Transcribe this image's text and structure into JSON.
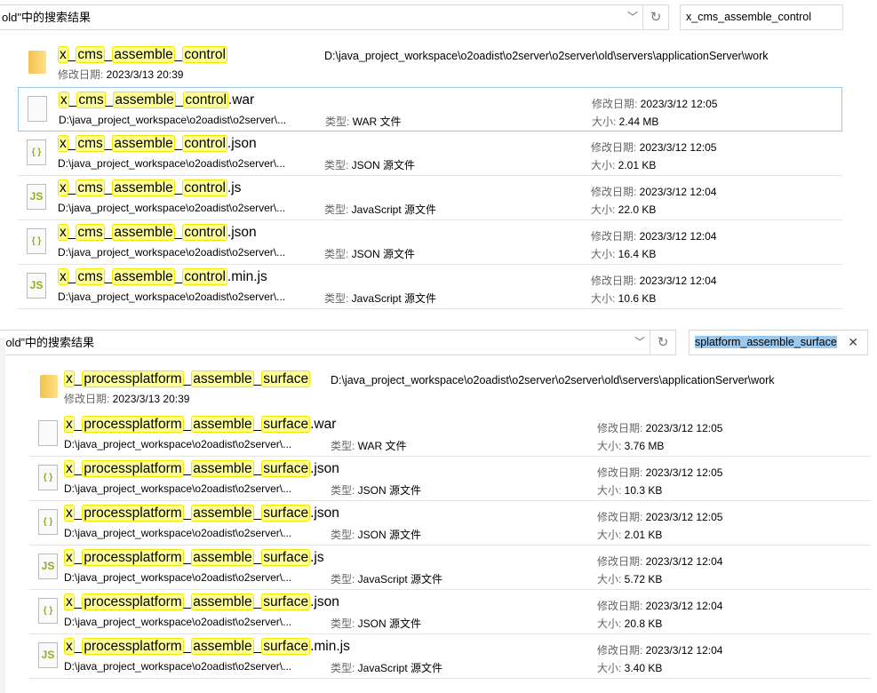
{
  "labels": {
    "date": "修改日期: ",
    "size": "大小: ",
    "type": "类型: "
  },
  "top": {
    "address": "old\"中的搜索结果",
    "search": "x_cms_assemble_control",
    "folder": {
      "parts": [
        "x",
        "cms",
        "assemble",
        "control"
      ],
      "date": "2023/3/13 20:39",
      "path": "D:\\java_project_workspace\\o2oadist\\o2server\\o2server\\old\\servers\\applicationServer\\work"
    },
    "items": [
      {
        "parts": [
          "x",
          "cms",
          "assemble",
          "control"
        ],
        "ext": ".war",
        "icon": "file",
        "path": "D:\\java_project_workspace\\o2oadist\\o2server\\...",
        "type": "WAR 文件",
        "date": "2023/3/12 12:05",
        "size": "2.44 MB"
      },
      {
        "parts": [
          "x",
          "cms",
          "assemble",
          "control"
        ],
        "ext": ".json",
        "icon": "json",
        "path": "D:\\java_project_workspace\\o2oadist\\o2server\\...",
        "type": "JSON 源文件",
        "date": "2023/3/12 12:05",
        "size": "2.01 KB"
      },
      {
        "parts": [
          "x",
          "cms",
          "assemble",
          "control"
        ],
        "ext": ".js",
        "icon": "js",
        "path": "D:\\java_project_workspace\\o2oadist\\o2server\\...",
        "type": "JavaScript 源文件",
        "date": "2023/3/12 12:04",
        "size": "22.0 KB"
      },
      {
        "parts": [
          "x",
          "cms",
          "assemble",
          "control"
        ],
        "ext": ".json",
        "icon": "json",
        "path": "D:\\java_project_workspace\\o2oadist\\o2server\\...",
        "type": "JSON 源文件",
        "date": "2023/3/12 12:04",
        "size": "16.4 KB"
      },
      {
        "parts": [
          "x",
          "cms",
          "assemble",
          "control"
        ],
        "ext": ".min.js",
        "icon": "js",
        "path": "D:\\java_project_workspace\\o2oadist\\o2server\\...",
        "type": "JavaScript 源文件",
        "date": "2023/3/12 12:04",
        "size": "10.6 KB"
      }
    ]
  },
  "bottom": {
    "address": "“old”中的搜索结果",
    "search": "splatform_assemble_surface",
    "folder": {
      "parts": [
        "x",
        "processplatform",
        "assemble",
        "surface"
      ],
      "date": "2023/3/13 20:39",
      "path": "D:\\java_project_workspace\\o2oadist\\o2server\\o2server\\old\\servers\\applicationServer\\work"
    },
    "items": [
      {
        "parts": [
          "x",
          "processplatform",
          "assemble",
          "surface"
        ],
        "ext": ".war",
        "icon": "file",
        "path": "D:\\java_project_workspace\\o2oadist\\o2server\\...",
        "type": "WAR 文件",
        "date": "2023/3/12 12:05",
        "size": "3.76 MB"
      },
      {
        "parts": [
          "x",
          "processplatform",
          "assemble",
          "surface"
        ],
        "ext": ".json",
        "icon": "json",
        "path": "D:\\java_project_workspace\\o2oadist\\o2server\\...",
        "type": "JSON 源文件",
        "date": "2023/3/12 12:05",
        "size": "10.3 KB"
      },
      {
        "parts": [
          "x",
          "processplatform",
          "assemble",
          "surface"
        ],
        "ext": ".json",
        "icon": "json",
        "path": "D:\\java_project_workspace\\o2oadist\\o2server\\...",
        "type": "JSON 源文件",
        "date": "2023/3/12 12:05",
        "size": "2.01 KB"
      },
      {
        "parts": [
          "x",
          "processplatform",
          "assemble",
          "surface"
        ],
        "ext": ".js",
        "icon": "js",
        "path": "D:\\java_project_workspace\\o2oadist\\o2server\\...",
        "type": "JavaScript 源文件",
        "date": "2023/3/12 12:04",
        "size": "5.72 KB"
      },
      {
        "parts": [
          "x",
          "processplatform",
          "assemble",
          "surface"
        ],
        "ext": ".json",
        "icon": "json",
        "path": "D:\\java_project_workspace\\o2oadist\\o2server\\...",
        "type": "JSON 源文件",
        "date": "2023/3/12 12:04",
        "size": "20.8 KB"
      },
      {
        "parts": [
          "x",
          "processplatform",
          "assemble",
          "surface"
        ],
        "ext": ".min.js",
        "icon": "js",
        "path": "D:\\java_project_workspace\\o2oadist\\o2server\\...",
        "type": "JavaScript 源文件",
        "date": "2023/3/12 12:04",
        "size": "3.40 KB"
      }
    ]
  }
}
